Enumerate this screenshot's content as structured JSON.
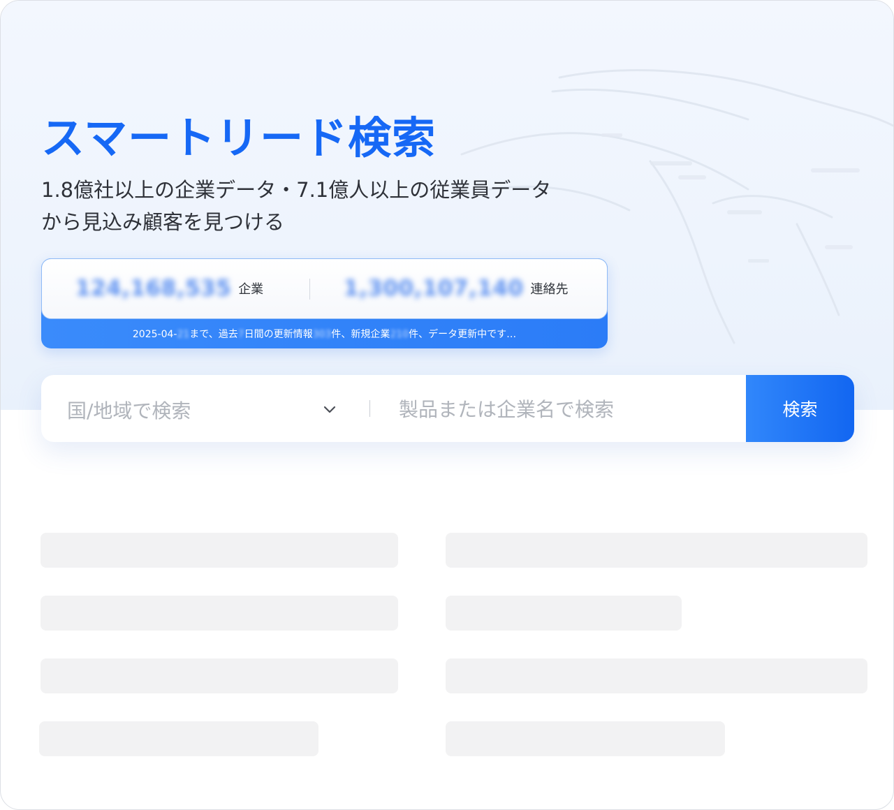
{
  "hero": {
    "title": "スマートリード検索",
    "subtitle_line1": "1.8億社以上の企業データ・7.1億人以上の従業員データ",
    "subtitle_line2": "から見込み顧客を見つける"
  },
  "stats": {
    "companies_count": "124,168,535",
    "companies_label": "企業",
    "contacts_count": "1,300,107,140",
    "contacts_label": "連絡先",
    "note": {
      "date_prefix": "2025-04-",
      "date_day": "21",
      "t1": "まで、過去",
      "days": "7",
      "t2": "日間の更新情報",
      "updates": "303",
      "t3": "件、新規企業",
      "new_companies": "210",
      "t4": "件、データ更新中です…"
    }
  },
  "search": {
    "country_placeholder": "国/地域で検索",
    "query_placeholder": "製品または企業名で検索",
    "button_label": "検索"
  },
  "colors": {
    "accent": "#1668f5",
    "button": "#1266f1",
    "skeleton": "#f2f2f3",
    "hero_background": "#eef4fd"
  },
  "icons": {
    "dropdown": "chevron-down-icon",
    "map": "world-map-decoration"
  }
}
